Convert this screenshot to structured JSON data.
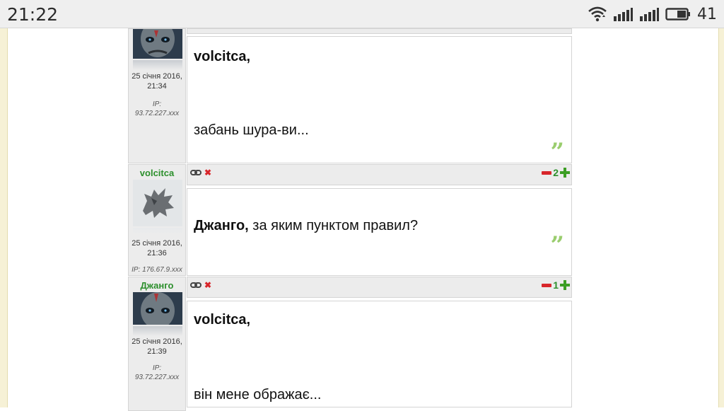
{
  "status_bar": {
    "time": "21:22",
    "battery_level": "41",
    "icons": [
      "wifi-icon",
      "signal-icon",
      "signal-icon",
      "battery-icon"
    ]
  },
  "posts": [
    {
      "author": "",
      "date": "25 січня 2016,",
      "time": "21:34",
      "ip_label": "IP:",
      "ip": "93.72.227.xxx",
      "addressee": "volcitca,",
      "text": "забань шура-ви...",
      "rating": ""
    },
    {
      "author": "volcitca",
      "date": "25 січня 2016,",
      "time": "21:36",
      "ip_label": "IP:",
      "ip": "176.67.9.xxx",
      "addressee": "Джанго,",
      "text": "за яким пунктом правил?",
      "rating": "2"
    },
    {
      "author": "Джанго",
      "date": "25 січня 2016,",
      "time": "21:39",
      "ip_label": "IP:",
      "ip": "93.72.227.xxx",
      "addressee": "volcitca,",
      "text": "він мене ображає...",
      "rating": "1"
    }
  ],
  "icons": {
    "link": "link-icon",
    "delete": "delete-icon",
    "quote": "quote-icon",
    "vote_down": "minus-icon",
    "vote_up": "plus-icon"
  },
  "colors": {
    "username": "#2c8f2c",
    "quote": "#9acd6e",
    "vote_down": "#d8262b",
    "vote_up": "#3c9e24",
    "panel": "#ececec",
    "side_band": "#f6f1d6"
  }
}
